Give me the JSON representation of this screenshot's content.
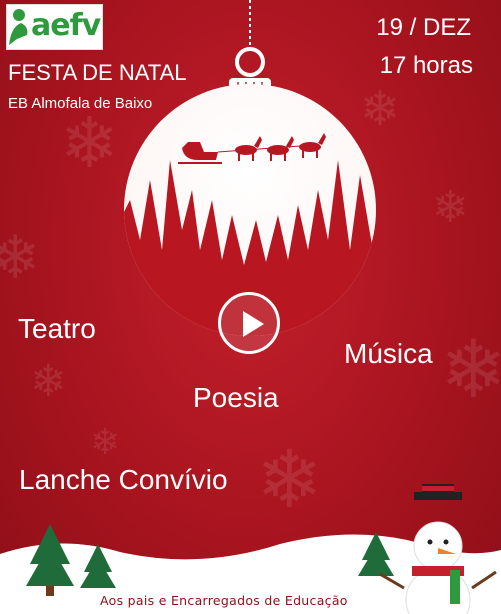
{
  "logo": {
    "text": "aefv",
    "icon": "person-figure-icon"
  },
  "header": {
    "title": "FESTA DE NATAL",
    "school": "EB Almofala de Baixo",
    "date": "19 / DEZ",
    "time": "17 horas"
  },
  "ornament": {
    "icon": "christmas-bauble-icon",
    "scene": "santa-sleigh-reindeer-forest"
  },
  "player": {
    "icon": "play-icon"
  },
  "activities": {
    "teatro": "Teatro",
    "musica": "Música",
    "poesia": "Poesia",
    "lanche": "Lanche Convívio"
  },
  "footer": {
    "text": "Aos pais e Encarregados de Educação"
  },
  "colors": {
    "background": "#a8141f",
    "accent_green": "#2e9a3e",
    "text": "#ffffff"
  }
}
